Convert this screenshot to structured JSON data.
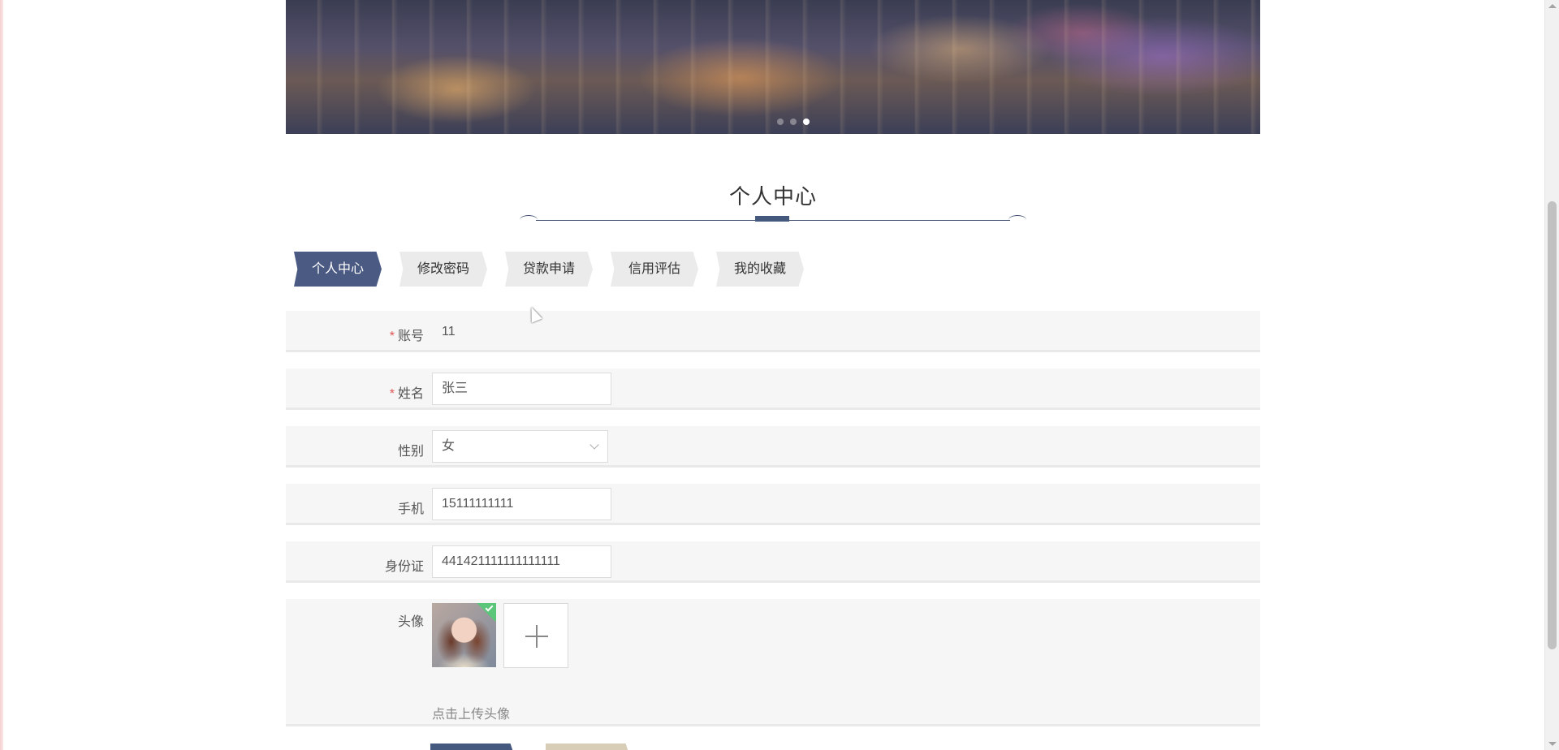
{
  "banner": {
    "slide_count": 3,
    "active_slide": 3
  },
  "section": {
    "title": "个人中心"
  },
  "tabs": [
    {
      "label": "个人中心",
      "active": true
    },
    {
      "label": "修改密码",
      "active": false
    },
    {
      "label": "贷款申请",
      "active": false
    },
    {
      "label": "信用评估",
      "active": false
    },
    {
      "label": "我的收藏",
      "active": false
    }
  ],
  "form": {
    "required_mark": "*",
    "account": {
      "label": "账号",
      "value": "11"
    },
    "name": {
      "label": "姓名",
      "value": "张三"
    },
    "gender": {
      "label": "性别",
      "value": "女"
    },
    "phone": {
      "label": "手机",
      "value": "15111111111"
    },
    "id_card": {
      "label": "身份证",
      "value": "441421111111111111"
    },
    "avatar": {
      "label": "头像",
      "upload_tip": "点击上传头像"
    }
  },
  "colors": {
    "accent": "#4a5a83",
    "tab_inactive": "#ebebeb",
    "row_bg": "#f6f6f6",
    "required": "#e05555",
    "upload_success": "#5bc57a"
  }
}
